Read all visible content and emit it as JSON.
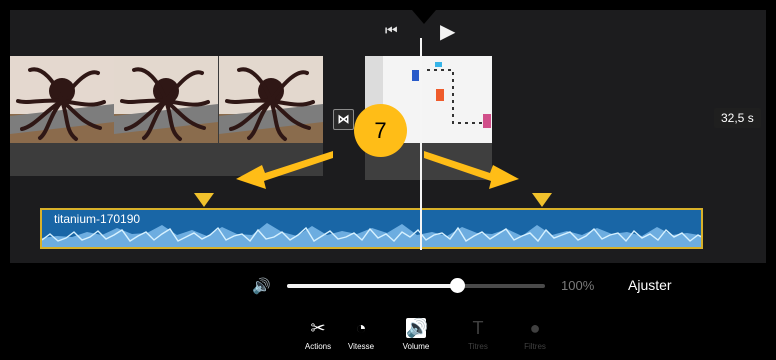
{
  "player": {
    "skip_icon": "⏮",
    "play_icon": "▶"
  },
  "timeline": {
    "duration": "32,5 s",
    "transition_icon": "⋈",
    "audio_clip": "titanium-170190",
    "annotation": "7"
  },
  "controls": {
    "volume_icon": "🔊",
    "volume_percent": "100%",
    "adjust_label": "Ajuster"
  },
  "toolbar": {
    "items": [
      {
        "label": "Actions",
        "icon": "✂"
      },
      {
        "label": "Vitesse",
        "icon": "◔"
      },
      {
        "label": "Volume",
        "icon": "🔊"
      },
      {
        "label": "Titres",
        "icon": "T"
      },
      {
        "label": "Filtres",
        "icon": "●"
      }
    ]
  },
  "colors": {
    "accent": "#ffbd17",
    "audio_track": "#1966a6",
    "audio_border": "#d8b12a",
    "marker": "#f0c12c"
  }
}
